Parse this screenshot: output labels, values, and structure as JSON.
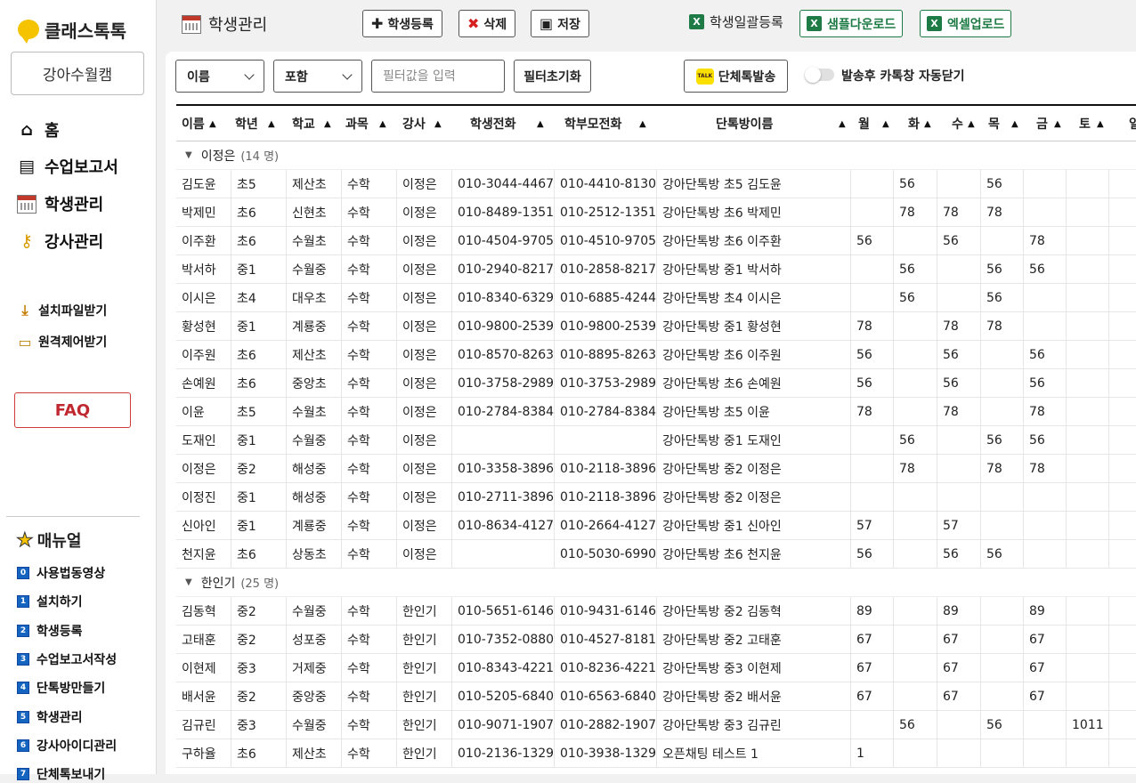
{
  "sidebar": {
    "logo": "클래스톡톡",
    "academy": "강아수월캠",
    "nav": [
      {
        "label": "홈",
        "icon": "home-icon"
      },
      {
        "label": "수업보고서",
        "icon": "document-icon"
      },
      {
        "label": "학생관리",
        "icon": "calendar-icon"
      },
      {
        "label": "강사관리",
        "icon": "key-icon"
      }
    ],
    "sub": [
      {
        "label": "설치파일받기",
        "icon": "download-icon"
      },
      {
        "label": "원격제어받기",
        "icon": "keyboard-icon"
      }
    ],
    "faq": "FAQ",
    "manual_title": "매뉴얼",
    "manual": [
      {
        "num": "0",
        "label": "사용법동영상"
      },
      {
        "num": "1",
        "label": "설치하기"
      },
      {
        "num": "2",
        "label": "학생등록"
      },
      {
        "num": "3",
        "label": "수업보고서작성"
      },
      {
        "num": "4",
        "label": "단톡방만들기"
      },
      {
        "num": "5",
        "label": "학생관리"
      },
      {
        "num": "6",
        "label": "강사아이디관리"
      },
      {
        "num": "7",
        "label": "단체톡보내기"
      }
    ]
  },
  "topbar": {
    "title": "학생관리",
    "add_label": "학생등록",
    "delete_label": "삭제",
    "save_label": "저장",
    "bulk_label": "학생일괄등록",
    "sample_label": "샘플다운로드",
    "excel_label": "엑셀업로드"
  },
  "filter": {
    "field": "이름",
    "mode": "포함",
    "placeholder": "필터값을 입력",
    "reset_label": "필터초기화",
    "send_label": "단체톡발송",
    "kakao_badge": "TALK",
    "toggle_label": "발송후 카톡창 자동닫기",
    "toggle_on": false
  },
  "columns": [
    "이름",
    "학년",
    "학교",
    "과목",
    "강사",
    "학생전화",
    "학부모전화",
    "단톡방이름",
    "월",
    "화",
    "수",
    "목",
    "금",
    "토",
    "일"
  ],
  "groups": [
    {
      "name": "이정은",
      "count": "(14 명)",
      "rows": [
        [
          "김도윤",
          "초5",
          "제산초",
          "수학",
          "이정은",
          "010-3044-4467",
          "010-4410-8130",
          "강아단톡방 초5 김도윤",
          "",
          "56",
          "",
          "56",
          "",
          "",
          ""
        ],
        [
          "박제민",
          "초6",
          "신현초",
          "수학",
          "이정은",
          "010-8489-1351",
          "010-2512-1351",
          "강아단톡방 초6 박제민",
          "",
          "78",
          "78",
          "78",
          "",
          "",
          ""
        ],
        [
          "이주환",
          "초6",
          "수월초",
          "수학",
          "이정은",
          "010-4504-9705",
          "010-4510-9705",
          "강아단톡방 초6 이주환",
          "56",
          "",
          "56",
          "",
          "78",
          "",
          ""
        ],
        [
          "박서하",
          "중1",
          "수월중",
          "수학",
          "이정은",
          "010-2940-8217",
          "010-2858-8217",
          "강아단톡방 중1 박서하",
          "",
          "56",
          "",
          "56",
          "56",
          "",
          ""
        ],
        [
          "이시은",
          "초4",
          "대우초",
          "수학",
          "이정은",
          "010-8340-6329",
          "010-6885-4244",
          "강아단톡방 초4 이시은",
          "",
          "56",
          "",
          "56",
          "",
          "",
          ""
        ],
        [
          "황성현",
          "중1",
          "계룡중",
          "수학",
          "이정은",
          "010-9800-2539",
          "010-9800-2539",
          "강아단톡방 중1 황성현",
          "78",
          "",
          "78",
          "78",
          "",
          "",
          ""
        ],
        [
          "이주원",
          "초6",
          "제산초",
          "수학",
          "이정은",
          "010-8570-8263",
          "010-8895-8263",
          "강아단톡방 초6 이주원",
          "56",
          "",
          "56",
          "",
          "56",
          "",
          ""
        ],
        [
          "손예원",
          "초6",
          "중앙초",
          "수학",
          "이정은",
          "010-3758-2989",
          "010-3753-2989",
          "강아단톡방 초6 손예원",
          "56",
          "",
          "56",
          "",
          "56",
          "",
          ""
        ],
        [
          "이윤",
          "초5",
          "수월초",
          "수학",
          "이정은",
          "010-2784-8384",
          "010-2784-8384",
          "강아단톡방 초5 이윤",
          "78",
          "",
          "78",
          "",
          "78",
          "",
          ""
        ],
        [
          "도재인",
          "중1",
          "수월중",
          "수학",
          "이정은",
          "",
          "",
          "강아단톡방 중1 도재인",
          "",
          "56",
          "",
          "56",
          "56",
          "",
          ""
        ],
        [
          "이정은",
          "중2",
          "해성중",
          "수학",
          "이정은",
          "010-3358-3896",
          "010-2118-3896",
          "강아단톡방 중2 이정은",
          "",
          "78",
          "",
          "78",
          "78",
          "",
          ""
        ],
        [
          "이정진",
          "중1",
          "해성중",
          "수학",
          "이정은",
          "010-2711-3896",
          "010-2118-3896",
          "강아단톡방 중2 이정은",
          "",
          "",
          "",
          "",
          "",
          "",
          ""
        ],
        [
          "신아인",
          "중1",
          "계룡중",
          "수학",
          "이정은",
          "010-8634-4127",
          "010-2664-4127",
          "강아단톡방 중1 신아인",
          "57",
          "",
          "57",
          "",
          "",
          "",
          ""
        ],
        [
          "천지윤",
          "초6",
          "상동초",
          "수학",
          "이정은",
          "",
          "010-5030-6990",
          "강아단톡방 초6 천지윤",
          "56",
          "",
          "56",
          "56",
          "",
          "",
          ""
        ]
      ]
    },
    {
      "name": "한인기",
      "count": "(25 명)",
      "rows": [
        [
          "김동혁",
          "중2",
          "수월중",
          "수학",
          "한인기",
          "010-5651-6146",
          "010-9431-6146",
          "강아단톡방 중2 김동혁",
          "89",
          "",
          "89",
          "",
          "89",
          "",
          ""
        ],
        [
          "고태훈",
          "중2",
          "성포중",
          "수학",
          "한인기",
          "010-7352-0880",
          "010-4527-8181",
          "강아단톡방 중2 고태훈",
          "67",
          "",
          "67",
          "",
          "67",
          "",
          ""
        ],
        [
          "이현제",
          "중3",
          "거제중",
          "수학",
          "한인기",
          "010-8343-4221",
          "010-8236-4221",
          "강아단톡방 중3 이현제",
          "67",
          "",
          "67",
          "",
          "67",
          "",
          ""
        ],
        [
          "배서윤",
          "중2",
          "중앙중",
          "수학",
          "한인기",
          "010-5205-6840",
          "010-6563-6840",
          "강아단톡방 중2 배서윤",
          "67",
          "",
          "67",
          "",
          "67",
          "",
          ""
        ],
        [
          "김규린",
          "중3",
          "수월중",
          "수학",
          "한인기",
          "010-9071-1907",
          "010-2882-1907",
          "강아단톡방 중3 김규린",
          "",
          "56",
          "",
          "56",
          "",
          "1011",
          ""
        ],
        [
          "구하율",
          "초6",
          "제산초",
          "수학",
          "한인기",
          "010-2136-1329",
          "010-3938-1329",
          "오픈채팅 테스트 1",
          "1",
          "",
          "",
          "",
          "",
          "",
          ""
        ]
      ]
    }
  ]
}
